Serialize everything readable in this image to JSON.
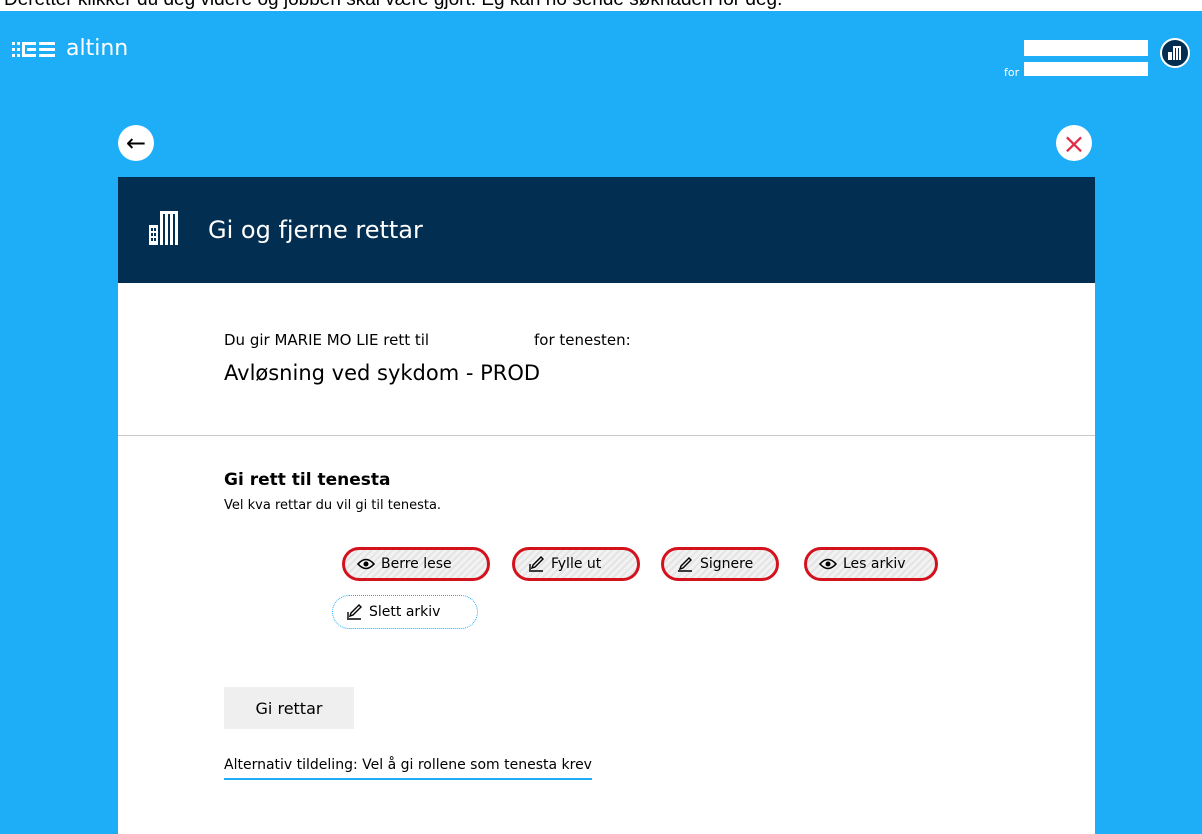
{
  "caption": "Deretter klikker du deg videre og jobben skal være gjort. Eg kan no sende søknaden for deg.",
  "app": {
    "logo_text": "altinn"
  },
  "profile": {
    "for_label": "for"
  },
  "modal": {
    "title": "Gi og fjerne rettar",
    "intro_prefix": "Du gir MARIE MO LIE rett til",
    "intro_suffix": "for tenesten:",
    "service_name": "Avløsning ved sykdom - PROD"
  },
  "rights": {
    "title": "Gi rett til tenesta",
    "subtitle": "Vel kva rettar du vil gi til tenesta.",
    "options": [
      {
        "label": "Berre lese",
        "icon": "eye-icon",
        "selected": true
      },
      {
        "label": "Fylle ut",
        "icon": "edit-icon",
        "selected": true
      },
      {
        "label": "Signere",
        "icon": "pen-icon",
        "selected": true
      },
      {
        "label": "Les arkiv",
        "icon": "eye-icon",
        "selected": true
      },
      {
        "label": "Slett arkiv",
        "icon": "edit-icon",
        "selected": false
      }
    ]
  },
  "actions": {
    "give_rights": "Gi rettar",
    "alternative_link": "Alternativ tildeling: Vel å gi rollene som tenesta krev"
  },
  "colors": {
    "background": "#1eaef7",
    "header": "#022f51",
    "highlight": "#d4121e",
    "close": "#e02e49"
  }
}
